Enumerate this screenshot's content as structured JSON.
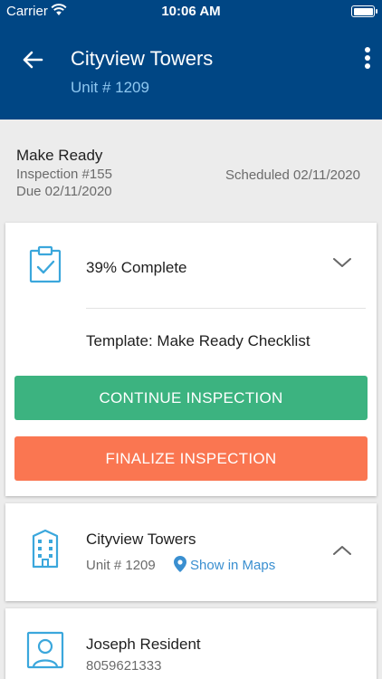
{
  "status_bar": {
    "carrier": "Carrier",
    "time": "10:06 AM"
  },
  "header": {
    "title": "Cityview Towers",
    "subtitle": "Unit # 1209"
  },
  "summary": {
    "type": "Make Ready",
    "inspection": "Inspection #155",
    "due": "Due 02/11/2020",
    "scheduled": "Scheduled 02/11/2020"
  },
  "inspection_card": {
    "progress_label": "39% Complete",
    "template": "Template: Make Ready Checklist",
    "continue_label": "CONTINUE INSPECTION",
    "finalize_label": "FINALIZE INSPECTION"
  },
  "property_card": {
    "name": "Cityview Towers",
    "unit": "Unit # 1209",
    "maps_label": "Show in Maps"
  },
  "resident_card": {
    "name": "Joseph Resident",
    "phone": "8059621333"
  },
  "colors": {
    "header_bg": "#004684",
    "accent_blue": "#3a8fd0",
    "continue_green": "#3cb380",
    "finalize_orange": "#fa7651"
  },
  "icons": [
    "back-arrow-icon",
    "more-vertical-icon",
    "clipboard-check-icon",
    "chevron-down-icon",
    "building-icon",
    "chevron-up-icon",
    "map-pin-icon",
    "person-badge-icon",
    "wifi-icon",
    "battery-icon"
  ]
}
